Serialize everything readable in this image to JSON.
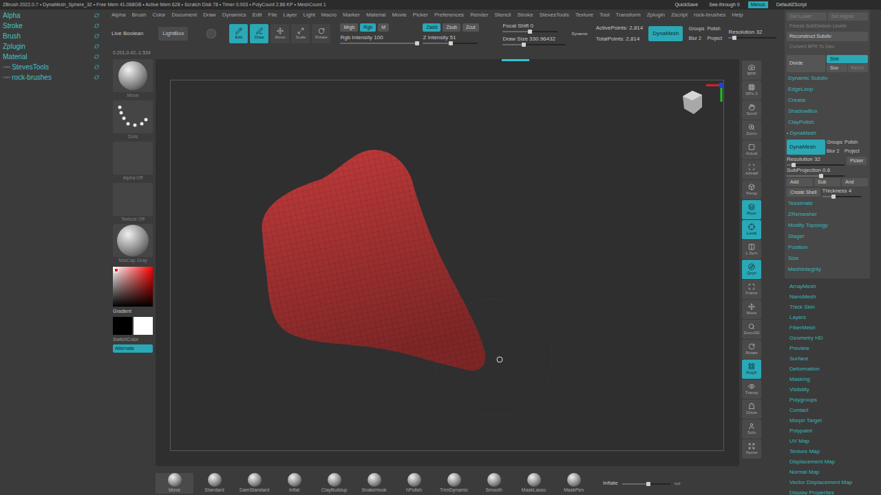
{
  "title_bar": {
    "text": "ZBrush 2022.0.7 • DynaMesh_Sphere_32 • Free Mem 41.068GB • Active Mem 628 • Scratch Disk 78 • Timer 0.003 • PolyCount 2.86 KP • MeshCount 1",
    "buttons": [
      {
        "label": "QuickSave",
        "on": false
      },
      {
        "label": "See-through 0",
        "on": false
      },
      {
        "label": "Menus",
        "on": true
      },
      {
        "label": "DefaultZScript",
        "on": false
      }
    ]
  },
  "menus": [
    "Alpha",
    "Brush",
    "Color",
    "Document",
    "Draw",
    "Dynamics",
    "Edit",
    "File",
    "Layer",
    "Light",
    "Macro",
    "Marker",
    "Material",
    "Movie",
    "Picker",
    "Preferences",
    "Render",
    "Stencil",
    "Stroke",
    "StevesTools",
    "Texture",
    "Tool",
    "Transform",
    "Zplugin",
    "Zscript",
    "rock-brushes",
    "Help"
  ],
  "tray": [
    {
      "label": "Alpha",
      "tag": ""
    },
    {
      "label": "Stroke",
      "tag": ""
    },
    {
      "label": "Brush",
      "tag": ""
    },
    {
      "label": "Zplugin",
      "tag": ""
    },
    {
      "label": "Material",
      "tag": ""
    },
    {
      "label": "StevesTools",
      "tag": "USER"
    },
    {
      "label": "rock-brushes",
      "tag": "USER"
    }
  ],
  "shelf": {
    "left_buttons": [
      {
        "label": "Live Boolean",
        "on": false
      },
      {
        "label": "LightBox",
        "on": false
      }
    ],
    "modes": [
      {
        "label": "Edit",
        "on": true
      },
      {
        "label": "Draw",
        "on": true
      },
      {
        "label": "Move",
        "on": false
      },
      {
        "label": "Scale",
        "on": false
      },
      {
        "label": "Rotate",
        "on": false
      }
    ],
    "color_modes": [
      {
        "label": "Mrgb",
        "on": false
      },
      {
        "label": "Rgb",
        "on": true
      },
      {
        "label": "M",
        "on": false
      }
    ],
    "rgb_intensity": {
      "label": "Rgb Intensity 100",
      "level": 1
    },
    "z_modes": [
      {
        "label": "Zadd",
        "on": true
      },
      {
        "label": "Zsub",
        "on": false
      },
      {
        "label": "Zcut",
        "on": false
      }
    ],
    "z_intensity": {
      "label": "Z Intensity 51",
      "level": 0.51
    },
    "focal_shift": {
      "label": "Focal Shift 0",
      "level": 0.5
    },
    "draw_size": {
      "label": "Draw Size 330.96432",
      "level": 0.33
    },
    "dynamic": "Dynamic",
    "stats": [
      "ActivePoints: 2,814",
      "TotalPoints: 2,814"
    ],
    "dynamesh": {
      "label": "DynaMesh",
      "on": true
    },
    "dynamesh_options": [
      "Groups",
      "Polish",
      "Blur 2",
      "Project"
    ],
    "resolution": {
      "label": "Resolution 32",
      "level": 0.12
    }
  },
  "coordinates": "0.201,0.42,-1.534",
  "left_shelf": {
    "thumbnails": [
      {
        "label": "Move",
        "kind": "brush"
      },
      {
        "label": "Dots",
        "kind": "stroke"
      },
      {
        "label": "Alpha Off",
        "kind": "empty"
      },
      {
        "label": "Texture Off",
        "kind": "empty"
      },
      {
        "label": "MatCap Gray",
        "kind": "material"
      }
    ],
    "main_color": "#ff0000",
    "gradient": "Gradient",
    "switch_color": "SwitchColor",
    "alternate": {
      "label": "Alternate",
      "on": true
    }
  },
  "right_shelf": [
    {
      "label": "BPR",
      "on": false
    },
    {
      "label": "SPix 3",
      "on": false
    },
    {
      "label": "Scroll",
      "on": false
    },
    {
      "label": "Zoom",
      "on": false
    },
    {
      "label": "Actual",
      "on": false
    },
    {
      "label": "AAHalf",
      "on": false
    },
    {
      "label": "Persp",
      "on": false
    },
    {
      "label": "Floor",
      "on": true
    },
    {
      "label": "Local",
      "on": true
    },
    {
      "label": "L.Sym",
      "on": false
    },
    {
      "label": "Qxyz",
      "on": true
    },
    {
      "label": "Frame",
      "on": false
    },
    {
      "label": "Move",
      "on": false
    },
    {
      "label": "Zoom3D",
      "on": false
    },
    {
      "label": "Rotate",
      "on": false
    },
    {
      "label": "PolyF",
      "on": true
    },
    {
      "label": "Transp",
      "on": false
    },
    {
      "label": "Ghost",
      "on": false
    },
    {
      "label": "Solo",
      "on": false
    },
    {
      "label": "Xpose",
      "on": false
    }
  ],
  "tool_palette": {
    "subdiv_buttons": [
      {
        "label": "Del Lower",
        "disabled": true
      },
      {
        "label": "Del Higher",
        "disabled": true
      }
    ],
    "wide_buttons": [
      {
        "label": "Freeze SubDivision Levels",
        "disabled": true
      },
      {
        "label": "Reconstruct Subdiv",
        "disabled": false
      },
      {
        "label": "Convert BPR To Geo",
        "disabled": true
      }
    ],
    "divide": "Divide",
    "divide_options": [
      {
        "label": "Smt",
        "on": true,
        "disabled": false
      },
      {
        "label": "Suv",
        "on": false,
        "disabled": false
      },
      {
        "label": "ReUV",
        "on": false,
        "disabled": true
      }
    ],
    "subpalettes_top": [
      "Dynamic Subdiv",
      "EdgeLoop",
      "Crease",
      "ShadowBox",
      "ClayPolish"
    ],
    "dynamesh": {
      "marker": "•",
      "header": "DynaMesh",
      "expanded": true,
      "button": {
        "label": "DynaMesh",
        "on": true
      },
      "options": [
        "Groups",
        "Polish",
        "Blur 2",
        "Project"
      ],
      "resolution": {
        "label": "Resolution 32",
        "level": 0.12
      },
      "picker": "Picker",
      "subprojection": {
        "label": "SubProjection 0.6",
        "level": 0.6
      },
      "booleans": [
        "Add",
        "Sub",
        "And"
      ],
      "create_shell": "Create Shell",
      "thickness": {
        "label": "Thickness 4",
        "level": 0.3
      }
    },
    "subpalettes_mid": [
      "Tessimate",
      "ZRemesher",
      "Modify Topology",
      "Stager",
      "Position",
      "Size",
      "MeshIntegrity"
    ],
    "subpalettes": [
      "ArrayMesh",
      "NanoMesh",
      "Thick Skin",
      "Layers",
      "FiberMesh",
      "Geometry HD",
      "Preview",
      "Surface",
      "Deformation",
      "Masking",
      "Visibility",
      "Polygroups",
      "Contact",
      "Morph Target",
      "Polypaint",
      "UV Map",
      "Texture Map",
      "Displacement Map",
      "Normal Map",
      "Vector Displacement Map",
      "Display Properties"
    ]
  },
  "brushes": [
    "Move",
    "Standard",
    "DamStandard",
    "Inflat",
    "ClayBuildup",
    "SnakeHook",
    "hPolish",
    "TrimDynamic",
    "Smooth",
    "MaskLasso",
    "MaskPen"
  ],
  "inflate": {
    "label": "Inflate",
    "level": 0.55,
    "axes": "xyz"
  }
}
